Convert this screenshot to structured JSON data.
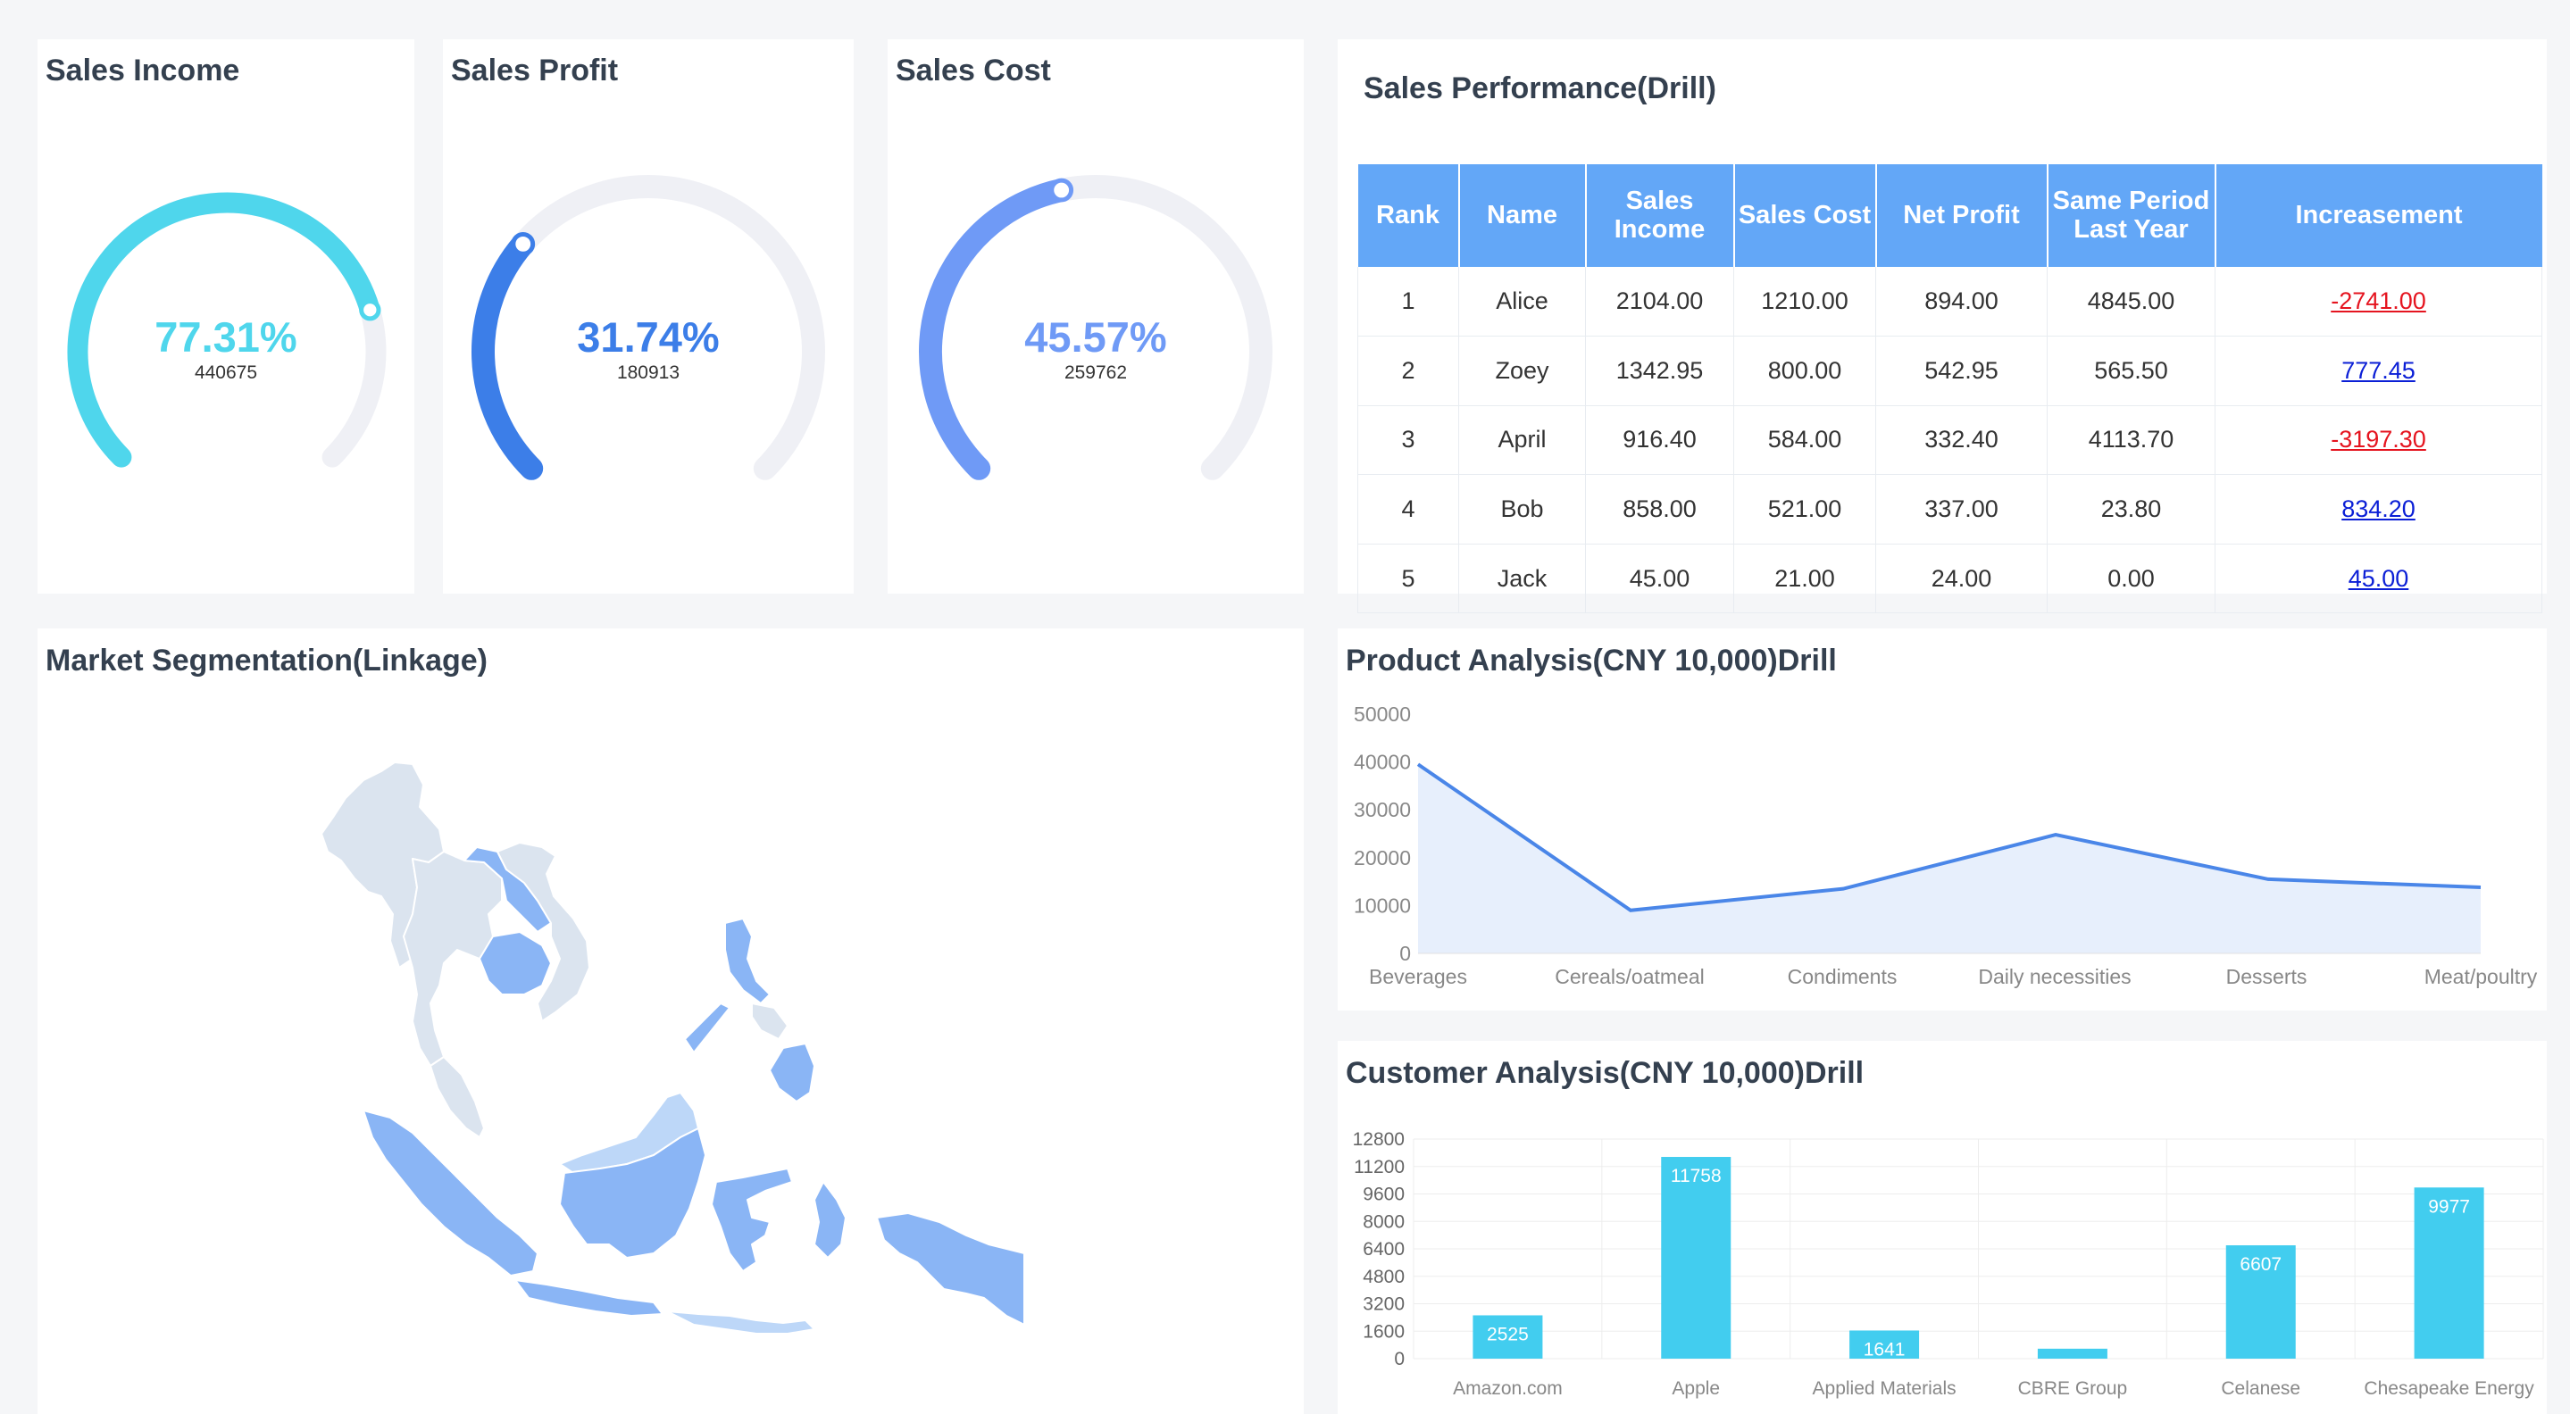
{
  "gauges": [
    {
      "title": "Sales Income",
      "percent_label": "77.31%",
      "value": "440675",
      "percent": 77.31,
      "color": "#4fd6ec"
    },
    {
      "title": "Sales Profit",
      "percent_label": "31.74%",
      "value": "180913",
      "percent": 31.74,
      "color": "#3c7ee8"
    },
    {
      "title": "Sales Cost",
      "percent_label": "45.57%",
      "value": "259762",
      "percent": 45.57,
      "color": "#6f9af6"
    }
  ],
  "performance": {
    "title": "Sales Performance(Drill)",
    "columns": [
      "Rank",
      "Name",
      "Sales Income",
      "Sales Cost",
      "Net Profit",
      "Same Period Last Year",
      "Increasement"
    ],
    "rows": [
      [
        "1",
        "Alice",
        "2104.00",
        "1210.00",
        "894.00",
        "4845.00",
        "-2741.00"
      ],
      [
        "2",
        "Zoey",
        "1342.95",
        "800.00",
        "542.95",
        "565.50",
        "777.45"
      ],
      [
        "3",
        "April",
        "916.40",
        "584.00",
        "332.40",
        "4113.70",
        "-3197.30"
      ],
      [
        "4",
        "Bob",
        "858.00",
        "521.00",
        "337.00",
        "23.80",
        "834.20"
      ],
      [
        "5",
        "Jack",
        "45.00",
        "21.00",
        "24.00",
        "0.00",
        "45.00"
      ]
    ]
  },
  "market": {
    "title": "Market Segmentation(Linkage)"
  },
  "product": {
    "title": "Product Analysis(CNY 10,000)Drill",
    "chart_data": {
      "type": "area",
      "categories": [
        "Beverages",
        "Cereals/oatmeal",
        "Condiments",
        "Daily necessities",
        "Desserts",
        "Meat/poultry"
      ],
      "x": [
        0,
        1,
        2,
        3,
        4,
        5
      ],
      "values": [
        39500,
        9000,
        13500,
        24800,
        15500,
        13800
      ],
      "y_ticks": [
        "0",
        "10000",
        "20000",
        "30000",
        "40000",
        "50000"
      ],
      "ylim": [
        0,
        50000
      ],
      "color": "#4a86e8"
    }
  },
  "customer": {
    "title": "Customer Analysis(CNY 10,000)Drill",
    "chart_data": {
      "type": "bar",
      "categories": [
        "Amazon.com",
        "Apple",
        "Applied Materials",
        "CBRE Group",
        "Celanese",
        "Chesapeake Energy"
      ],
      "values": [
        2525,
        11758,
        1641,
        580,
        6607,
        9977
      ],
      "value_labels": [
        "2525",
        "11758",
        "1641",
        "",
        "6607",
        "9977"
      ],
      "y_ticks": [
        "0",
        "1600",
        "3200",
        "4800",
        "6400",
        "8000",
        "9600",
        "11200",
        "12800"
      ],
      "ylim": [
        0,
        12800
      ],
      "color": "#42cdef"
    }
  }
}
